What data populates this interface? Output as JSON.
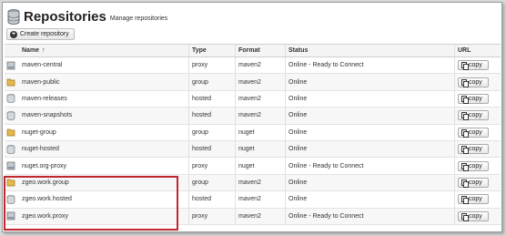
{
  "header": {
    "title": "Repositories",
    "subtitle": "Manage repositories"
  },
  "toolbar": {
    "create_label": "Create repository"
  },
  "table": {
    "columns": {
      "name": "Name",
      "type": "Type",
      "format": "Format",
      "status": "Status",
      "url": "URL"
    },
    "sort_indicator": "↑",
    "rows": [
      {
        "icon": "proxy-repo-icon",
        "name": "maven-central",
        "type": "proxy",
        "format": "maven2",
        "status": "Online - Ready to Connect",
        "copy": "copy"
      },
      {
        "icon": "group-repo-icon",
        "name": "maven-public",
        "type": "group",
        "format": "maven2",
        "status": "Online",
        "copy": "copy"
      },
      {
        "icon": "hosted-repo-icon",
        "name": "maven-releases",
        "type": "hosted",
        "format": "maven2",
        "status": "Online",
        "copy": "copy"
      },
      {
        "icon": "hosted-repo-icon",
        "name": "maven-snapshots",
        "type": "hosted",
        "format": "maven2",
        "status": "Online",
        "copy": "copy"
      },
      {
        "icon": "group-repo-icon",
        "name": "nuget-group",
        "type": "group",
        "format": "nuget",
        "status": "Online",
        "copy": "copy"
      },
      {
        "icon": "hosted-repo-icon",
        "name": "nuget-hosted",
        "type": "hosted",
        "format": "nuget",
        "status": "Online",
        "copy": "copy"
      },
      {
        "icon": "proxy-repo-icon",
        "name": "nuget.org-proxy",
        "type": "proxy",
        "format": "nuget",
        "status": "Online - Ready to Connect",
        "copy": "copy"
      },
      {
        "icon": "group-repo-icon",
        "name": "zgeo.work.group",
        "type": "group",
        "format": "maven2",
        "status": "Online",
        "copy": "copy"
      },
      {
        "icon": "hosted-repo-icon",
        "name": "zgeo.work.hosted",
        "type": "hosted",
        "format": "maven2",
        "status": "Online",
        "copy": "copy"
      },
      {
        "icon": "proxy-repo-icon",
        "name": "zgeo.work.proxy",
        "type": "proxy",
        "format": "maven2",
        "status": "Online - Ready to Connect",
        "copy": "copy"
      }
    ]
  },
  "colors": {
    "highlight": "#c0282e",
    "group_icon": "#e8b84a",
    "hosted_icon": "#b8c0c8"
  }
}
